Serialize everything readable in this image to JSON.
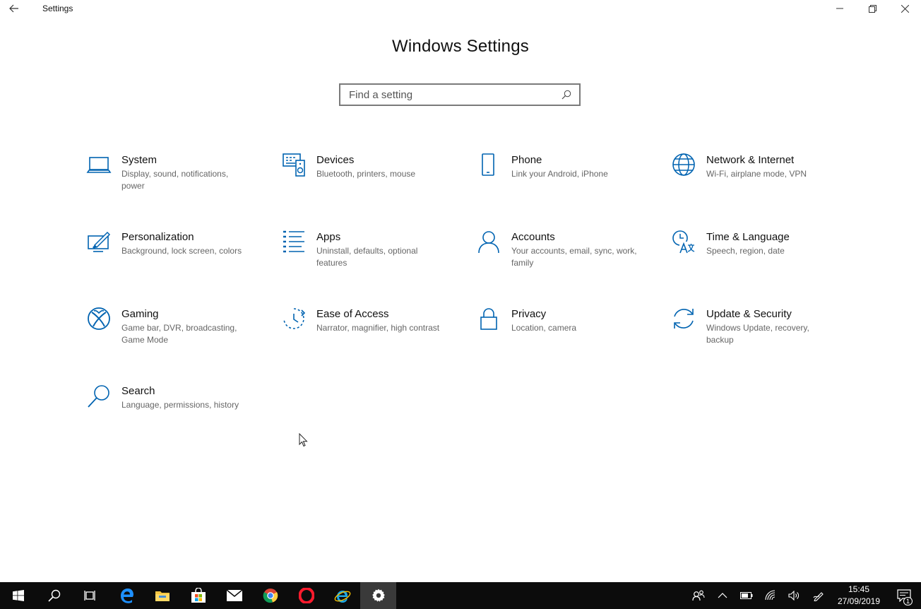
{
  "window": {
    "title": "Settings"
  },
  "header": {
    "title": "Windows Settings"
  },
  "search": {
    "placeholder": "Find a setting",
    "value": ""
  },
  "accent_color": "#0063b1",
  "tiles": [
    {
      "title": "System",
      "desc": "Display, sound, notifications, power",
      "icon": "laptop-icon"
    },
    {
      "title": "Devices",
      "desc": "Bluetooth, printers, mouse",
      "icon": "devices-icon"
    },
    {
      "title": "Phone",
      "desc": "Link your Android, iPhone",
      "icon": "phone-icon"
    },
    {
      "title": "Network & Internet",
      "desc": "Wi-Fi, airplane mode, VPN",
      "icon": "globe-icon"
    },
    {
      "title": "Personalization",
      "desc": "Background, lock screen, colors",
      "icon": "personalization-icon"
    },
    {
      "title": "Apps",
      "desc": "Uninstall, defaults, optional features",
      "icon": "apps-list-icon"
    },
    {
      "title": "Accounts",
      "desc": "Your accounts, email, sync, work, family",
      "icon": "person-icon"
    },
    {
      "title": "Time & Language",
      "desc": "Speech, region, date",
      "icon": "time-language-icon"
    },
    {
      "title": "Gaming",
      "desc": "Game bar, DVR, broadcasting, Game Mode",
      "icon": "xbox-icon"
    },
    {
      "title": "Ease of Access",
      "desc": "Narrator, magnifier, high contrast",
      "icon": "ease-of-access-icon"
    },
    {
      "title": "Privacy",
      "desc": "Location, camera",
      "icon": "lock-icon"
    },
    {
      "title": "Update & Security",
      "desc": "Windows Update, recovery, backup",
      "icon": "sync-icon"
    },
    {
      "title": "Search",
      "desc": "Language, permissions, history",
      "icon": "magnifier-icon"
    }
  ],
  "taskbar": {
    "apps": [
      "start-icon",
      "search-icon",
      "task-view-icon",
      "edge-icon",
      "file-explorer-icon",
      "store-icon",
      "mail-icon",
      "chrome-icon",
      "opera-icon",
      "internet-explorer-icon",
      "settings-gear-icon"
    ],
    "clock_time": "15:45",
    "clock_date": "27/09/2019",
    "notification_count": "1"
  }
}
